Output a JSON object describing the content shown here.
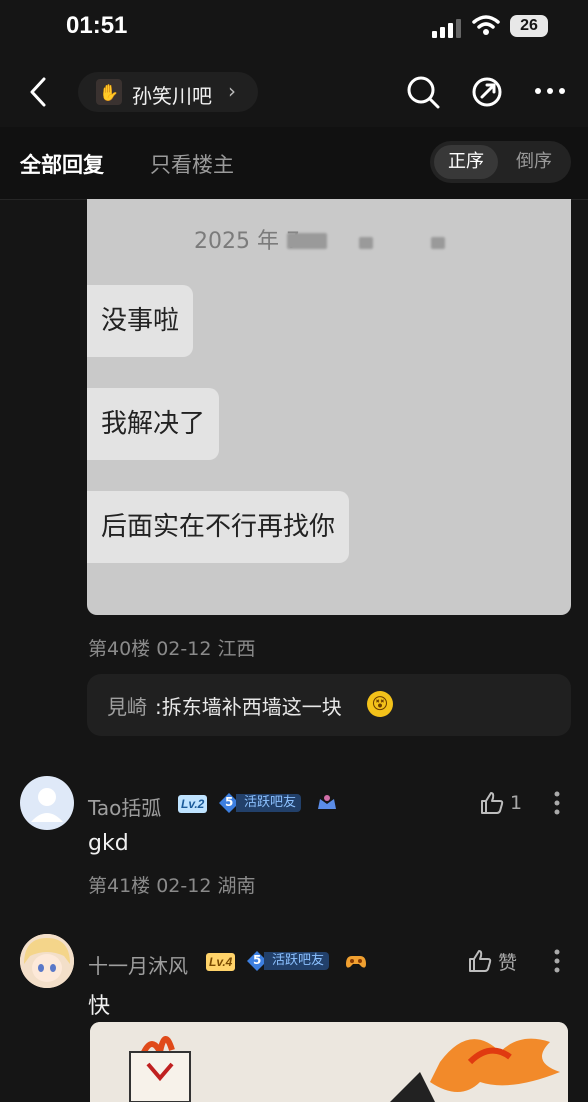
{
  "status_bar": {
    "time": "01:51",
    "battery": "26"
  },
  "nav": {
    "forum_name": "孙笑川吧",
    "forum_arrow": "›"
  },
  "tabs": {
    "all_replies": "全部回复",
    "owner_only": "只看楼主",
    "sort_asc": "正序",
    "sort_desc": "倒序"
  },
  "post40": {
    "screenshot": {
      "date_text": "2025 年 7",
      "bubbles": [
        "没事啦",
        "我解决了",
        "后面实在不行再找你"
      ]
    },
    "meta": "第40楼 02-12 江西",
    "sub_reply": {
      "author": "見崎",
      "text": ":拆东墙补西墙这一块",
      "emoji": "😵"
    }
  },
  "post41": {
    "username": "Tao括弧",
    "level": "Lv.2",
    "badge_number": "5",
    "badge_label": "活跃吧友",
    "content": "gkd",
    "likes": "1",
    "meta": "第41楼 02-12 湖南"
  },
  "post42": {
    "username": "十一月沐风",
    "level": "Lv.4",
    "badge_number": "5",
    "badge_label": "活跃吧友",
    "content": "快",
    "like_label": "赞"
  },
  "colors": {
    "background": "#151515",
    "badge_blue": "#22406a",
    "lv2": "#bfe3ff",
    "lv4": "#ffd36a"
  }
}
